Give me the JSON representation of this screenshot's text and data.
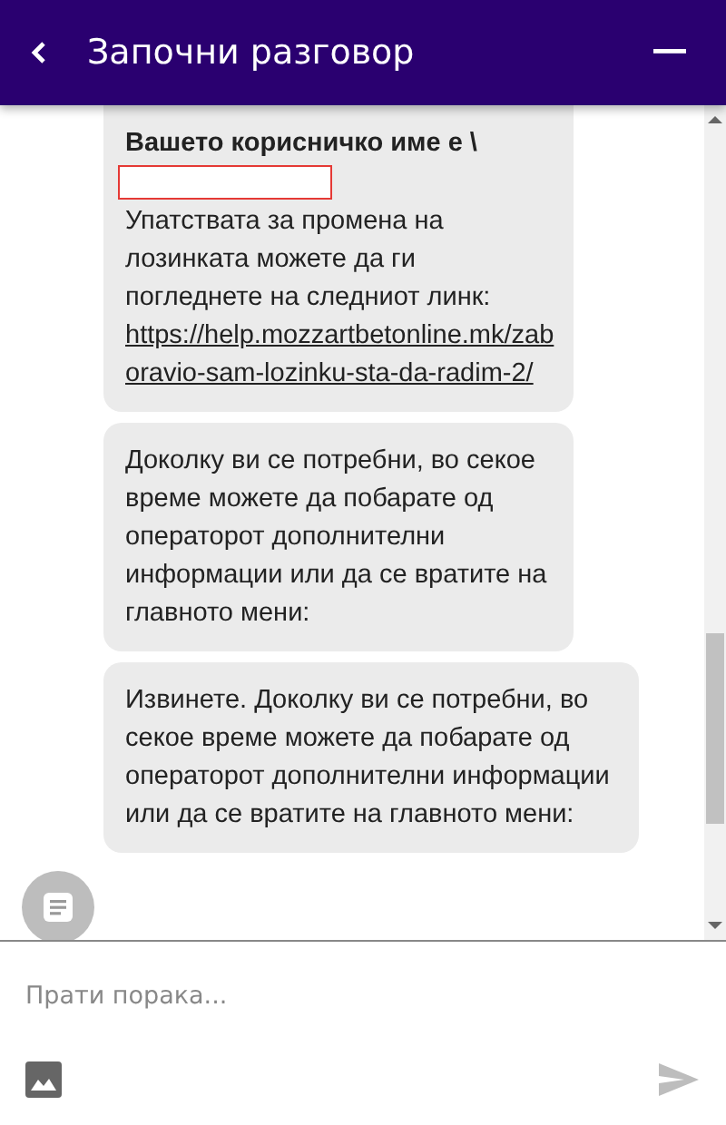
{
  "header": {
    "title": "Започни разговор"
  },
  "messages": [
    {
      "kind": "username",
      "heading": "Вашето корисничко име е \\",
      "text": "Упатствата за промена на лозинката можете да ги погледнете на следниот линк:",
      "link": "https://help.mozzartbetonline.mk/zaboravio-sam-lozinku-sta-da-radim-2/"
    },
    {
      "kind": "text",
      "text": "Доколку ви се потребни, во секое време можете да побарате од операторот дополнителни информации или да се вратите на главното мени:"
    },
    {
      "kind": "text",
      "text": "Извинете. Доколку ви се потребни, во секое време можете да побарате од операторот дополнителни информации или да се вратите на главното мени:"
    }
  ],
  "composer": {
    "placeholder": "Прати порака...",
    "send_disabled": true
  }
}
